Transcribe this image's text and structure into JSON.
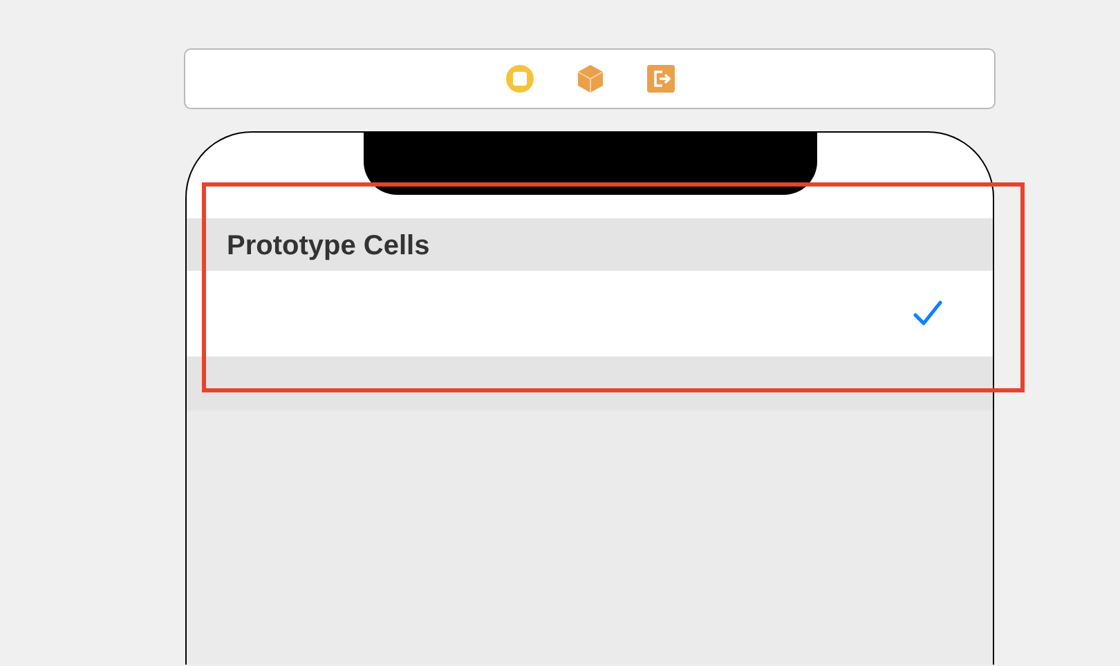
{
  "table": {
    "highlighted": true,
    "sections": [
      {
        "header": "Prototype Cells",
        "cells": [
          {
            "checked": true
          }
        ]
      }
    ]
  }
}
